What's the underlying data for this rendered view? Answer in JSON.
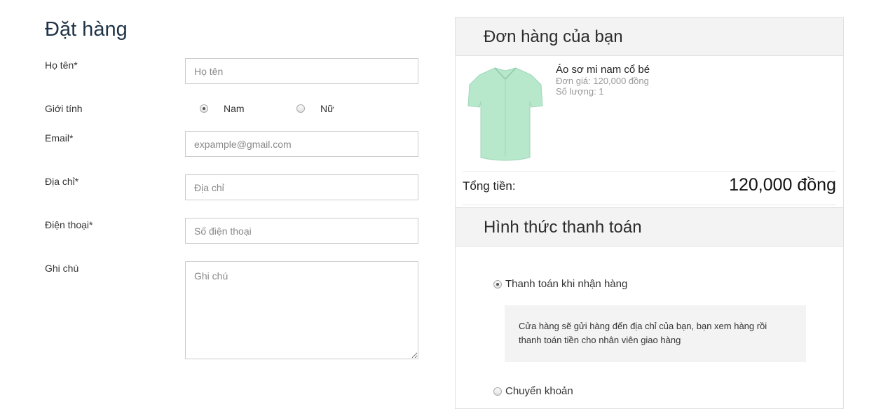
{
  "form": {
    "title": "Đặt hàng",
    "name": {
      "label": "Họ tên*",
      "placeholder": "Họ tên"
    },
    "gender": {
      "label": "Giới tính",
      "options": [
        "Nam",
        "Nữ"
      ],
      "selected": "Nam"
    },
    "email": {
      "label": "Email*",
      "placeholder": "expample@gmail.com"
    },
    "address": {
      "label": "Địa chỉ*",
      "placeholder": "Địa chỉ"
    },
    "phone": {
      "label": "Điện thoại*",
      "placeholder": "Số điện thoại"
    },
    "note": {
      "label": "Ghi chú",
      "placeholder": "Ghi chú"
    }
  },
  "order": {
    "heading": "Đơn hàng của bạn",
    "item": {
      "name": "Áo sơ mi nam cổ bé",
      "unit_price": "Đơn giá: 120,000 đồng",
      "quantity": "Số lượng: 1",
      "image_color": "#b7e8cc"
    },
    "total_label": "Tổng tiền:",
    "total_value": "120,000 đồng"
  },
  "payment": {
    "heading": "Hình thức thanh toán",
    "options": [
      {
        "label": "Thanh toán khi nhận hàng",
        "selected": true,
        "description": "Cửa hàng sẽ gửi hàng đến địa chỉ của bạn, bạn xem hàng rồi thanh toán tiền cho nhân viên giao hàng"
      },
      {
        "label": "Chuyển khoản",
        "selected": false
      }
    ]
  }
}
